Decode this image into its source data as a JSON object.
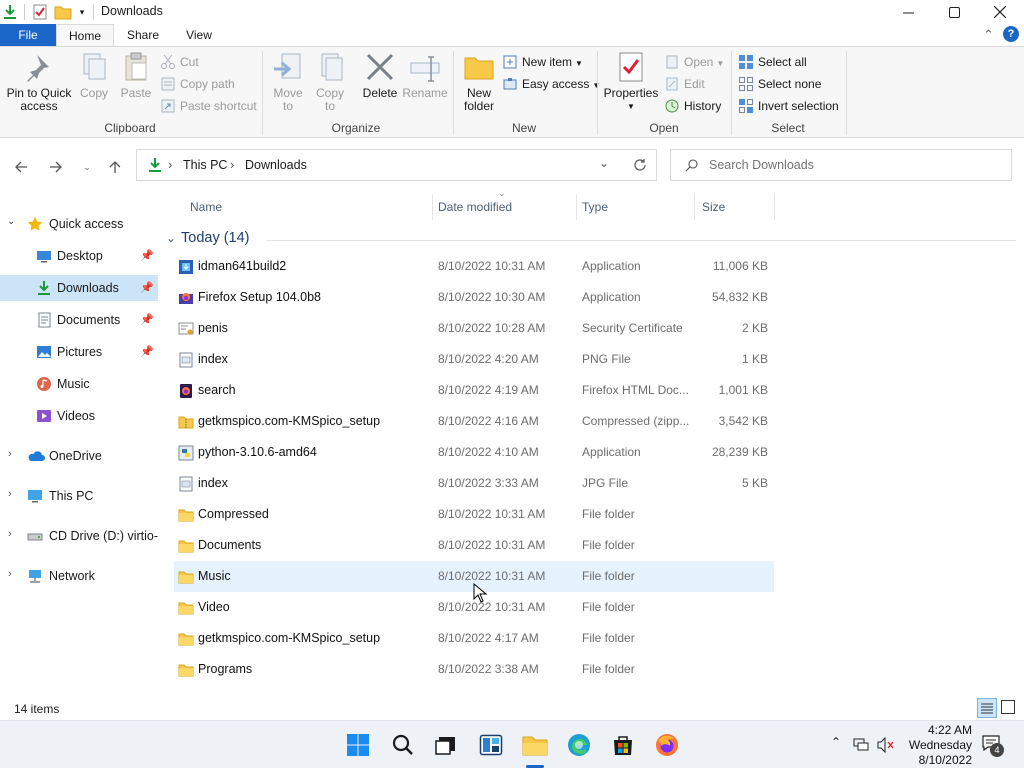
{
  "window": {
    "title": "Downloads",
    "controls": {
      "minimize": "—",
      "maximize": "☐",
      "close": "✕"
    }
  },
  "ribbon_tabs": {
    "file": "File",
    "home": "Home",
    "share": "Share",
    "view": "View"
  },
  "ribbon": {
    "clipboard": {
      "pin_line1": "Pin to Quick",
      "pin_line2": "access",
      "copy": "Copy",
      "paste": "Paste",
      "cut": "Cut",
      "copy_path": "Copy path",
      "paste_shortcut": "Paste shortcut",
      "group": "Clipboard"
    },
    "organize": {
      "move_line1": "Move",
      "move_line2": "to",
      "copy_line1": "Copy",
      "copy_line2": "to",
      "delete": "Delete",
      "rename": "Rename",
      "group": "Organize"
    },
    "new": {
      "folder_line1": "New",
      "folder_line2": "folder",
      "new_item": "New item",
      "easy_access": "Easy access",
      "group": "New"
    },
    "open": {
      "properties": "Properties",
      "open": "Open",
      "edit": "Edit",
      "history": "History",
      "group": "Open"
    },
    "select": {
      "select_all": "Select all",
      "select_none": "Select none",
      "invert": "Invert selection",
      "group": "Select"
    }
  },
  "address": {
    "crumbs": [
      "This PC",
      "Downloads"
    ],
    "separator": "›",
    "search_placeholder": "Search Downloads"
  },
  "nav": {
    "quick_access": "Quick access",
    "desktop": "Desktop",
    "downloads": "Downloads",
    "documents": "Documents",
    "pictures": "Pictures",
    "music": "Music",
    "videos": "Videos",
    "onedrive": "OneDrive",
    "this_pc": "This PC",
    "cd_drive": "CD Drive (D:) virtio-w",
    "network": "Network"
  },
  "columns": {
    "name": "Name",
    "date": "Date modified",
    "type": "Type",
    "size": "Size"
  },
  "group_header": "Today (14)",
  "files": [
    {
      "name": "idman641build2",
      "date": "8/10/2022 10:31 AM",
      "type": "Application",
      "size": "11,006 KB",
      "icon": "installer-icon"
    },
    {
      "name": "Firefox Setup 104.0b8",
      "date": "8/10/2022 10:30 AM",
      "type": "Application",
      "size": "54,832 KB",
      "icon": "firefox-setup-icon"
    },
    {
      "name": "penis",
      "date": "8/10/2022 10:28 AM",
      "type": "Security Certificate",
      "size": "2 KB",
      "icon": "certificate-icon"
    },
    {
      "name": "index",
      "date": "8/10/2022 4:20 AM",
      "type": "PNG File",
      "size": "1 KB",
      "icon": "image-file-icon"
    },
    {
      "name": "search",
      "date": "8/10/2022 4:19 AM",
      "type": "Firefox HTML Doc...",
      "size": "1,001 KB",
      "icon": "html-file-icon"
    },
    {
      "name": "getkmspico.com-KMSpico_setup",
      "date": "8/10/2022 4:16 AM",
      "type": "Compressed (zipp...",
      "size": "3,542 KB",
      "icon": "zip-folder-icon"
    },
    {
      "name": "python-3.10.6-amd64",
      "date": "8/10/2022 4:10 AM",
      "type": "Application",
      "size": "28,239 KB",
      "icon": "python-installer-icon"
    },
    {
      "name": "index",
      "date": "8/10/2022 3:33 AM",
      "type": "JPG File",
      "size": "5 KB",
      "icon": "image-file-icon"
    },
    {
      "name": "Compressed",
      "date": "8/10/2022 10:31 AM",
      "type": "File folder",
      "size": "",
      "icon": "folder-icon"
    },
    {
      "name": "Documents",
      "date": "8/10/2022 10:31 AM",
      "type": "File folder",
      "size": "",
      "icon": "folder-icon"
    },
    {
      "name": "Music",
      "date": "8/10/2022 10:31 AM",
      "type": "File folder",
      "size": "",
      "icon": "folder-icon"
    },
    {
      "name": "Video",
      "date": "8/10/2022 10:31 AM",
      "type": "File folder",
      "size": "",
      "icon": "folder-icon"
    },
    {
      "name": "getkmspico.com-KMSpico_setup",
      "date": "8/10/2022 4:17 AM",
      "type": "File folder",
      "size": "",
      "icon": "folder-icon"
    },
    {
      "name": "Programs",
      "date": "8/10/2022 3:38 AM",
      "type": "File folder",
      "size": "",
      "icon": "folder-icon"
    }
  ],
  "status": {
    "item_count": "14 items"
  },
  "taskbar": {
    "time": "4:22 AM",
    "day": "Wednesday",
    "date": "8/10/2022",
    "notification_count": "4"
  },
  "colors": {
    "accent": "#1a66c9",
    "selection": "#cce4f7",
    "hover": "#e5f3ff",
    "folder": "#f8c948"
  }
}
